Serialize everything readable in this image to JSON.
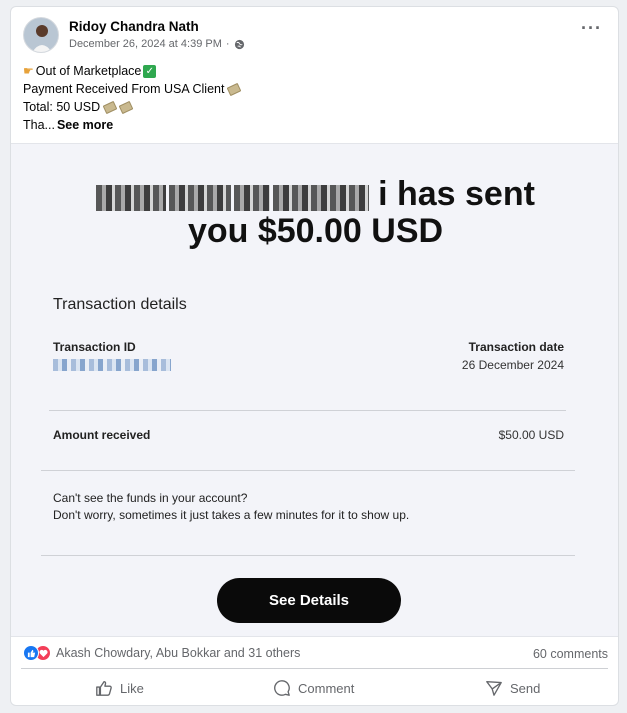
{
  "post": {
    "author": "Ridoy Chandra Nath",
    "timestamp": "December 26, 2024 at 4:39 PM",
    "separator": "·",
    "privacy_icon": "globe-icon",
    "more_icon": "ellipsis-icon",
    "text_lines": [
      "Out of Marketplace",
      "Payment Received From USA Client",
      "Total: 50 USD",
      "Tha..."
    ],
    "see_more": "See more"
  },
  "receipt": {
    "headline_line1": "i has sent",
    "headline_line2": "you $50.00 USD",
    "section_title": "Transaction details",
    "transaction_id_label": "Transaction ID",
    "transaction_date_label": "Transaction date",
    "transaction_date": "26 December 2024",
    "amount_label": "Amount received",
    "amount_value": "$50.00 USD",
    "help_line1": "Can't see the funds in your account?",
    "help_line2": "Don't worry, sometimes it just takes a few minutes for it to show up.",
    "button_label": "See Details"
  },
  "engagement": {
    "reactors": "Akash Chowdary, Abu Bokkar and 31 others",
    "comments": "60 comments",
    "actions": {
      "like": "Like",
      "comment": "Comment",
      "send": "Send"
    }
  },
  "colors": {
    "facebook_blue": "#1877f2",
    "love_red": "#f33e58",
    "secondary_text": "#65676b",
    "button_black": "#0a0a0a"
  }
}
